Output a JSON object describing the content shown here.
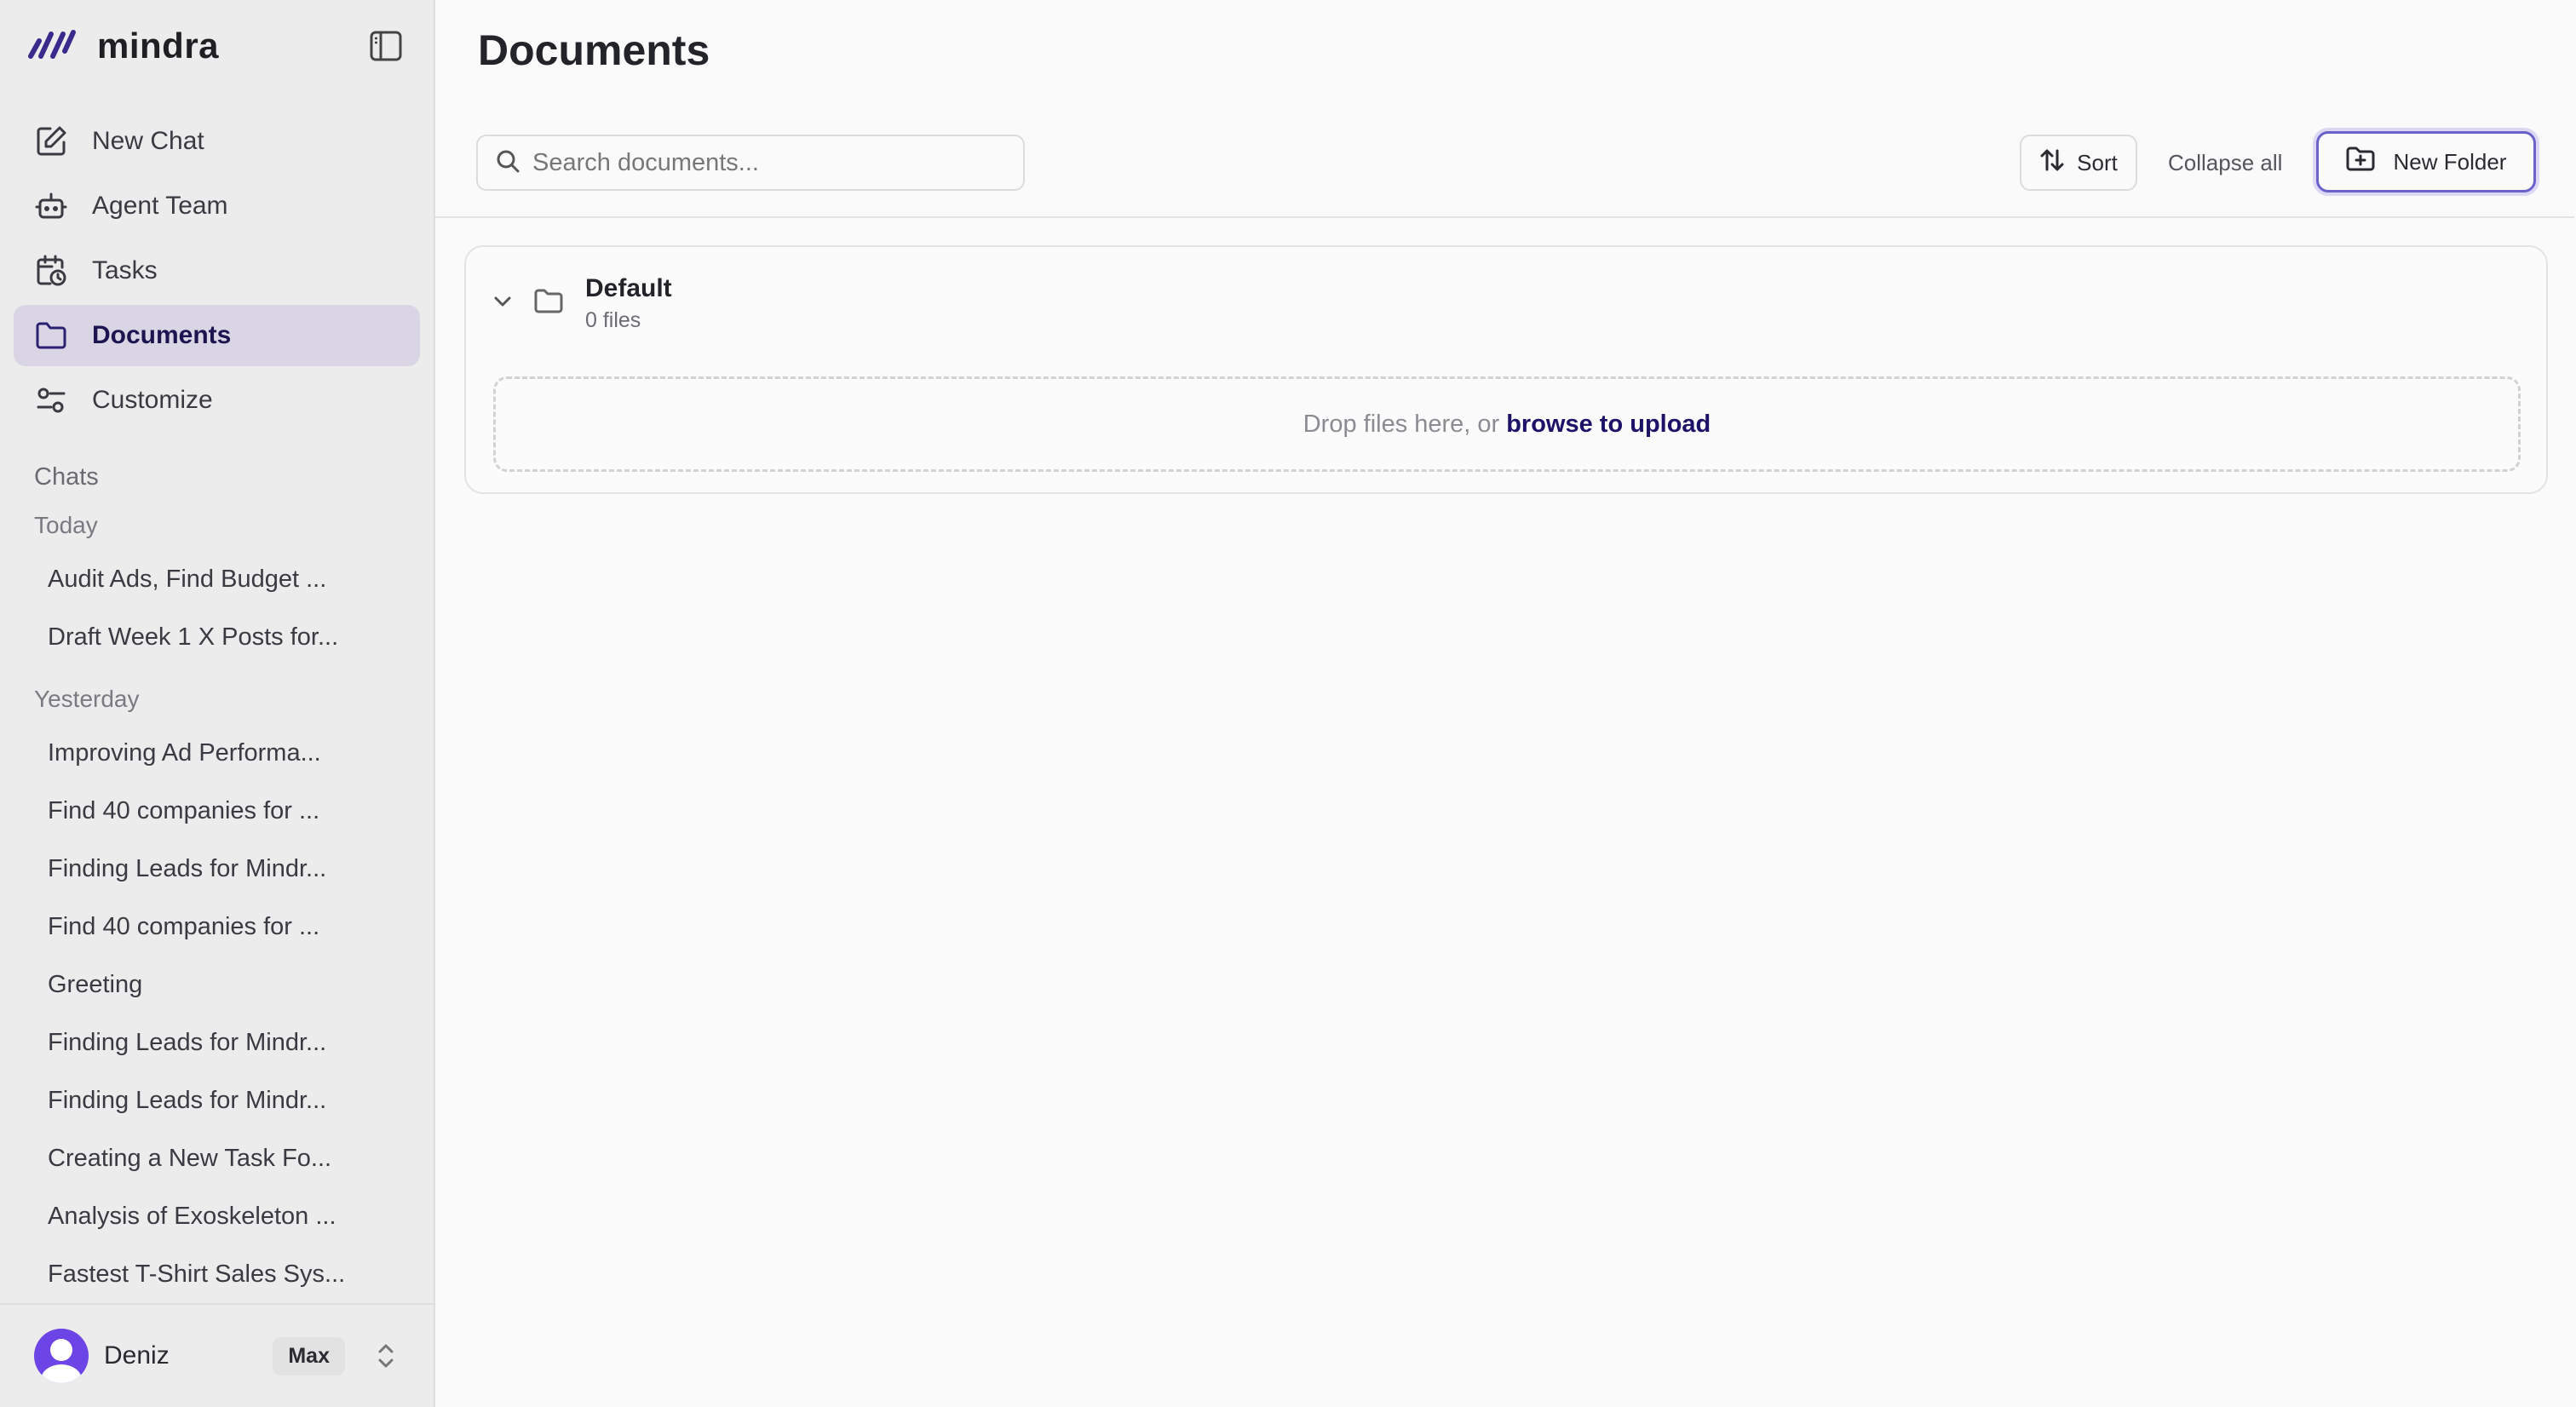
{
  "app": {
    "name": "mindra"
  },
  "sidebar": {
    "nav": [
      {
        "label": "New Chat",
        "icon": "edit-icon"
      },
      {
        "label": "Agent Team",
        "icon": "robot-icon"
      },
      {
        "label": "Tasks",
        "icon": "calendar-clock-icon"
      },
      {
        "label": "Documents",
        "icon": "folder-icon",
        "active": true
      },
      {
        "label": "Customize",
        "icon": "sliders-icon"
      }
    ],
    "chats_label": "Chats",
    "groups": [
      {
        "label": "Today",
        "items": [
          "Audit Ads, Find Budget ...",
          "Draft Week 1 X Posts for..."
        ]
      },
      {
        "label": "Yesterday",
        "items": [
          "Improving Ad Performa...",
          "Find 40 companies for ...",
          "Finding Leads for Mindr...",
          "Find 40 companies for ...",
          "Greeting",
          "Finding Leads for Mindr...",
          "Finding Leads for Mindr...",
          "Creating a New Task Fo...",
          "Analysis of Exoskeleton ...",
          "Fastest T-Shirt Sales Sys..."
        ]
      }
    ],
    "user": {
      "name": "Deniz",
      "plan": "Max"
    }
  },
  "main": {
    "title": "Documents",
    "search_placeholder": "Search documents...",
    "sort_label": "Sort",
    "collapse_label": "Collapse all",
    "new_folder_label": "New Folder",
    "folder": {
      "name": "Default",
      "count": "0 files",
      "drop_text": "Drop files here, or",
      "browse_text": "browse to upload"
    }
  },
  "colors": {
    "accent": "#1c1268",
    "active_bg": "#d9d5e4",
    "avatar": "#6d45e6",
    "focus_border": "#6b62c9"
  }
}
